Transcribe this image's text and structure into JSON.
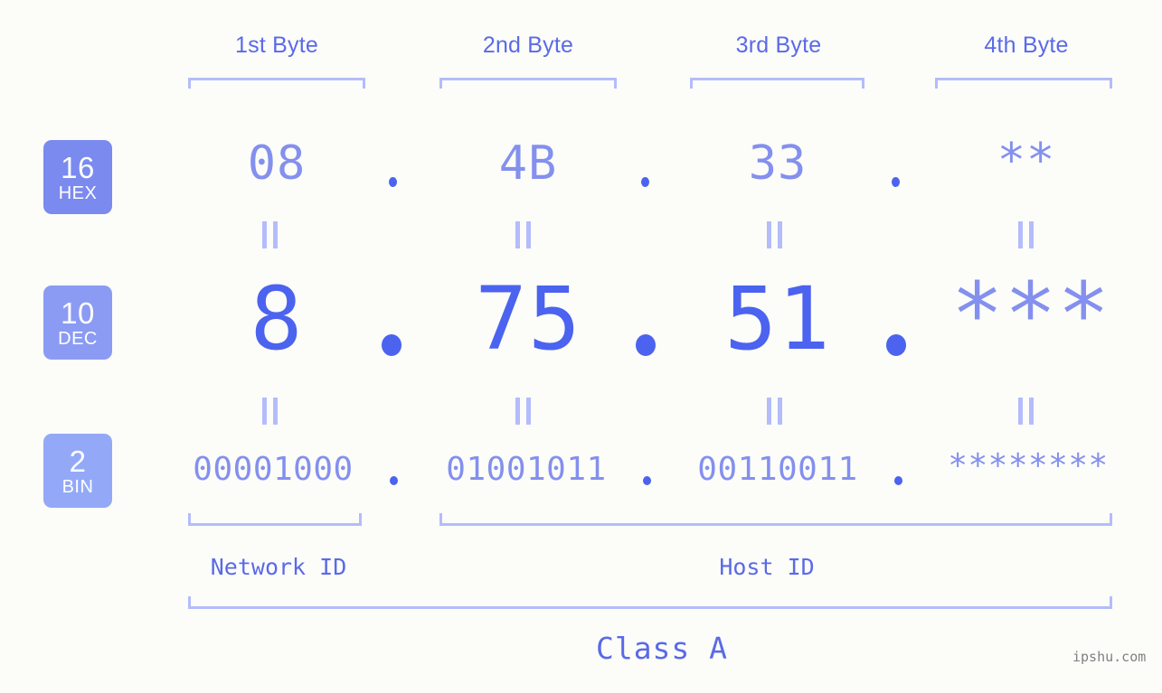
{
  "theme": {
    "background": "#fcfdf9",
    "accent_strong": "#4b63ef",
    "accent_mid": "#5a6ae8",
    "accent_soft": "#8490ee",
    "accent_light": "#b4bcfb",
    "badge_hex_bg": "#7b8aef",
    "badge_dec_bg": "#8b9bf3",
    "badge_bin_bg": "#93a9f7"
  },
  "byte_headers": [
    {
      "label": "1st Byte"
    },
    {
      "label": "2nd Byte"
    },
    {
      "label": "3rd Byte"
    },
    {
      "label": "4th Byte"
    }
  ],
  "rows": {
    "hex": {
      "badge_number": "16",
      "badge_label": "HEX",
      "values": [
        "08",
        "4B",
        "33",
        "**"
      ],
      "separator": "."
    },
    "dec": {
      "badge_number": "10",
      "badge_label": "DEC",
      "values": [
        "8",
        "75",
        "51",
        "***"
      ],
      "separator": "."
    },
    "bin": {
      "badge_number": "2",
      "badge_label": "BIN",
      "values": [
        "00001000",
        "01001011",
        "00110011",
        "********"
      ],
      "separator": "."
    }
  },
  "equals_glyph": "||",
  "segments": {
    "network_id": "Network ID",
    "host_id": "Host ID",
    "class": "Class A"
  },
  "watermark": "ipshu.com"
}
